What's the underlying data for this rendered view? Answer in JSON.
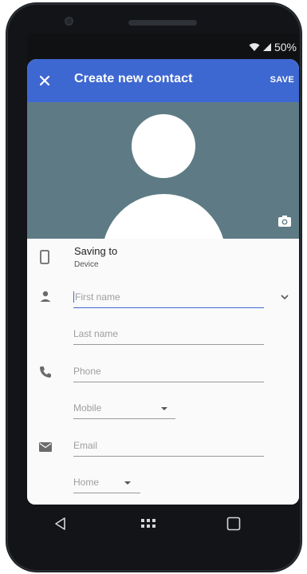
{
  "status": {
    "battery": "50%"
  },
  "appbar": {
    "title": "Create new contact",
    "save": "SAVE"
  },
  "saving": {
    "title": "Saving to",
    "subtitle": "Device"
  },
  "fields": {
    "first_name": "First name",
    "last_name": "Last name",
    "phone": "Phone",
    "phone_type": "Mobile",
    "email": "Email",
    "email_type": "Home"
  },
  "colors": {
    "primary": "#3e68d1",
    "photo_bg": "#5e7b85"
  }
}
